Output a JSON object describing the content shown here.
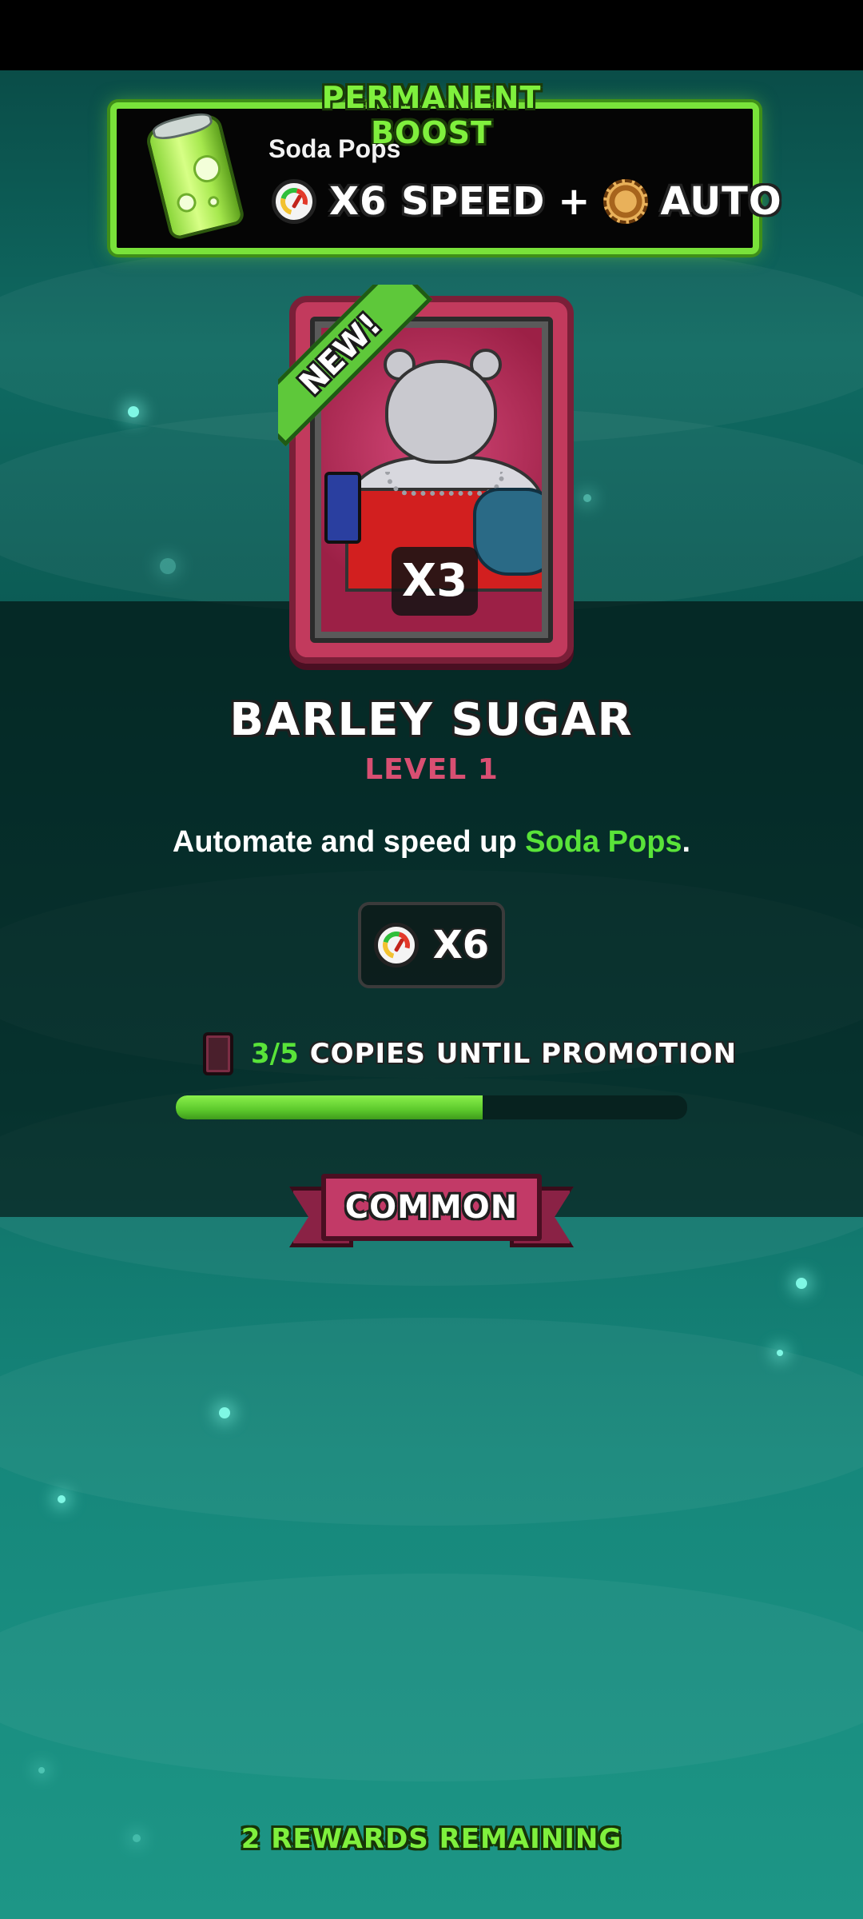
{
  "boost": {
    "title": "PERMANENT BOOST",
    "item_name": "Soda Pops",
    "speed_text": "X6 SPEED",
    "plus": "+",
    "auto_text": "AUTO",
    "icons": [
      "soda-can-icon",
      "speed-gauge-icon",
      "gear-icon"
    ]
  },
  "card": {
    "new_label": "NEW!",
    "count_badge": "X3",
    "name": "BARLEY SUGAR",
    "level": "LEVEL 1"
  },
  "description": {
    "prefix": "Automate and speed up ",
    "highlight": "Soda Pops",
    "suffix": "."
  },
  "multiplier": {
    "icon": "speed-gauge-icon",
    "label": "X6"
  },
  "promotion": {
    "count": "3/5",
    "label": "COPIES UNTIL PROMOTION",
    "progress_fraction": 0.6
  },
  "rarity": {
    "label": "COMMON"
  },
  "footer": {
    "rewards_remaining": "2 REWARDS REMAINING"
  },
  "colors": {
    "accent_green": "#59e339",
    "rarity_pink": "#c23a67",
    "boost_border": "#79e23a",
    "background_teal": "#0f6a62"
  }
}
